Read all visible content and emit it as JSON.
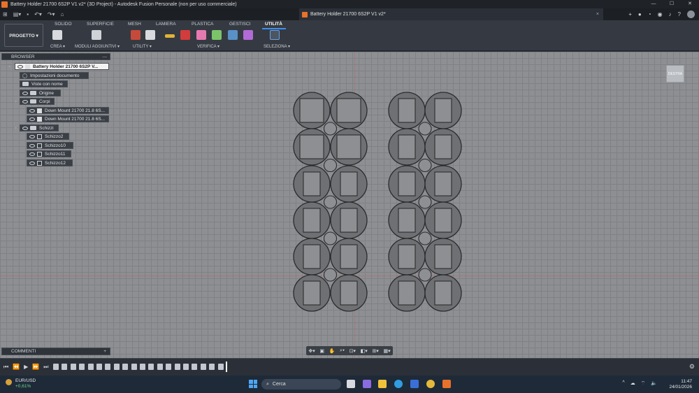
{
  "window": {
    "title": "Battery Holder 21700 6S2P V1 v2* (3D Project) - Autodesk Fusion Personale (non per uso commerciale)",
    "controls": [
      "—",
      "☐",
      "✕"
    ]
  },
  "document_tab": {
    "name": "Battery Holder 21700 6S2P V1 v2*",
    "close": "×"
  },
  "ribbon": {
    "workspace_button": "PROGETTO ▾",
    "tabs": [
      "SOLIDO",
      "SUPERFICIE",
      "MESH",
      "LAMIERA",
      "PLASTICA",
      "GESTISCI",
      "UTILITÀ"
    ],
    "active_tab": "UTILITÀ",
    "groups": [
      "CREA ▾",
      "MODULI AGGIUNTIVI ▾",
      "UTILITY ▾",
      "VERIFICA ▾",
      "SELEZIONA ▾"
    ]
  },
  "browser": {
    "title": "BROWSER",
    "root": "Battery Holder 21700 6S2P V...",
    "items": [
      {
        "label": "Impostazioni documento",
        "icon": "gear-icon"
      },
      {
        "label": "Viste con nome",
        "icon": "folder-icon"
      },
      {
        "label": "Origine",
        "icon": "folder-icon"
      },
      {
        "label": "Corpi",
        "icon": "folder-icon"
      },
      {
        "label": "Down Mount 21700 21.8 6S...",
        "icon": "body-icon"
      },
      {
        "label": "Down Mount 21700 21.8 6S...",
        "icon": "body-icon"
      },
      {
        "label": "Schizzi",
        "icon": "folder-icon"
      },
      {
        "label": "Schizzo2",
        "icon": "sketch-icon"
      },
      {
        "label": "Schizzo10",
        "icon": "sketch-icon"
      },
      {
        "label": "Schizzo11",
        "icon": "sketch-icon"
      },
      {
        "label": "Schizzo12",
        "icon": "sketch-icon"
      }
    ]
  },
  "comments": {
    "title": "COMMENTI",
    "add": "+"
  },
  "viewcube": {
    "label": "DESTRA"
  },
  "taskbar": {
    "ticker": "EUR/USD",
    "ticker_change": "+0,61%",
    "search_placeholder": "Cerca",
    "time": "11:47",
    "date": "24/01/2026"
  }
}
